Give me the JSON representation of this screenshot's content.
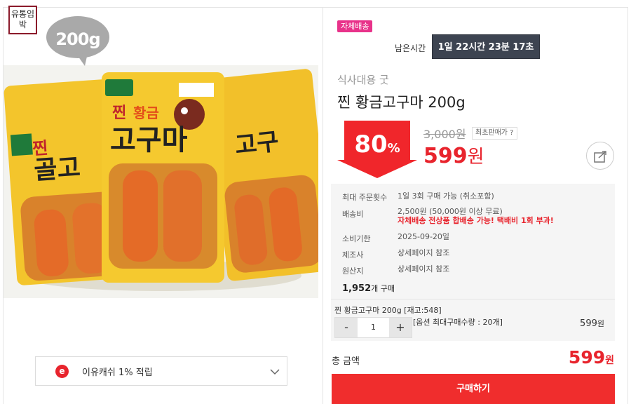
{
  "left": {
    "expiry_badge": "유통임박",
    "photo_weight_bubble": "200g",
    "point": {
      "icon": "e",
      "text": "이유캐쉬 1% 적립"
    }
  },
  "right": {
    "ship_badge": "자체배송",
    "remaining_label": "남은시간",
    "remaining_time": "1일 22시간 23분 17초",
    "subtitle": "식사대용 굿",
    "title": "찐 황금고구마 200g",
    "discount": {
      "value": "80",
      "unit": "%"
    },
    "original_price": "3,000원",
    "min_seller": "최초판매가 ?",
    "sale_price": {
      "value": "599",
      "unit": "원"
    },
    "info": [
      {
        "label": "최대 주문횟수",
        "value": "1일 3회 구매 가능 (취소포함)"
      },
      {
        "label": "배송비",
        "value": "2,500원 (50,000원 이상 무료)",
        "warn": "자체배송 전상품 합배송 가능! 택배비 1회 부과!"
      },
      {
        "label": "소비기한",
        "value": "2025-09-20일"
      },
      {
        "label": "제조사",
        "value": "상세페이지 참조"
      },
      {
        "label": "원산지",
        "value": "상세페이지 참조"
      }
    ],
    "sold": {
      "count": "1,952",
      "unit": "개 구매"
    },
    "option": {
      "name": "찐 황금고구마 200g [재고:548]",
      "minus": "-",
      "qty": "1",
      "plus": "+",
      "max": "[옵션 최대구매수량 : 20개]",
      "price": "599",
      "price_unit": "원"
    },
    "total": {
      "label": "총 금액",
      "price": "599",
      "unit": "원"
    },
    "buy_button": "구매하기"
  },
  "colors": {
    "accent_red": "#e8242d",
    "badge_pink": "#e8328a",
    "timer_bg": "#3d4451",
    "buy_red": "#f02d2d"
  }
}
